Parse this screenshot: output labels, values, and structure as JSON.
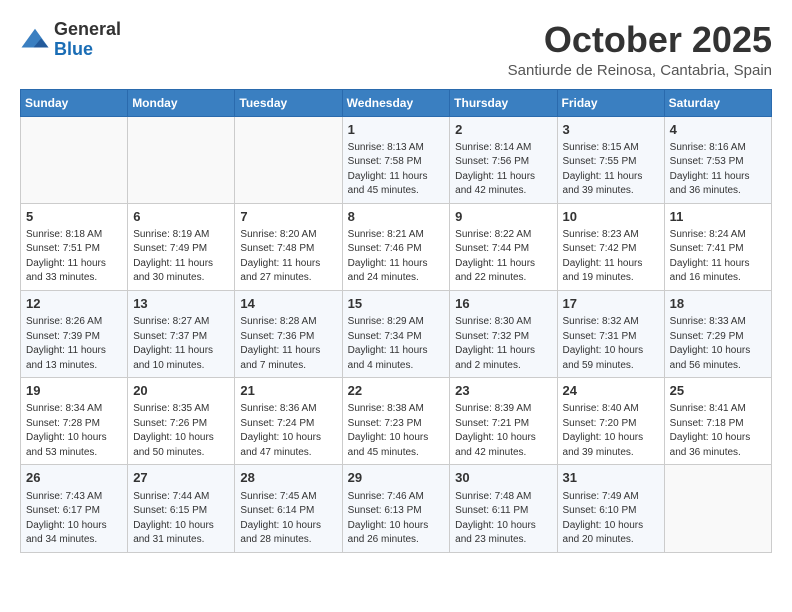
{
  "header": {
    "logo_general": "General",
    "logo_blue": "Blue",
    "month_title": "October 2025",
    "subtitle": "Santiurde de Reinosa, Cantabria, Spain"
  },
  "weekdays": [
    "Sunday",
    "Monday",
    "Tuesday",
    "Wednesday",
    "Thursday",
    "Friday",
    "Saturday"
  ],
  "weeks": [
    [
      {
        "day": "",
        "info": ""
      },
      {
        "day": "",
        "info": ""
      },
      {
        "day": "",
        "info": ""
      },
      {
        "day": "1",
        "info": "Sunrise: 8:13 AM\nSunset: 7:58 PM\nDaylight: 11 hours and 45 minutes."
      },
      {
        "day": "2",
        "info": "Sunrise: 8:14 AM\nSunset: 7:56 PM\nDaylight: 11 hours and 42 minutes."
      },
      {
        "day": "3",
        "info": "Sunrise: 8:15 AM\nSunset: 7:55 PM\nDaylight: 11 hours and 39 minutes."
      },
      {
        "day": "4",
        "info": "Sunrise: 8:16 AM\nSunset: 7:53 PM\nDaylight: 11 hours and 36 minutes."
      }
    ],
    [
      {
        "day": "5",
        "info": "Sunrise: 8:18 AM\nSunset: 7:51 PM\nDaylight: 11 hours and 33 minutes."
      },
      {
        "day": "6",
        "info": "Sunrise: 8:19 AM\nSunset: 7:49 PM\nDaylight: 11 hours and 30 minutes."
      },
      {
        "day": "7",
        "info": "Sunrise: 8:20 AM\nSunset: 7:48 PM\nDaylight: 11 hours and 27 minutes."
      },
      {
        "day": "8",
        "info": "Sunrise: 8:21 AM\nSunset: 7:46 PM\nDaylight: 11 hours and 24 minutes."
      },
      {
        "day": "9",
        "info": "Sunrise: 8:22 AM\nSunset: 7:44 PM\nDaylight: 11 hours and 22 minutes."
      },
      {
        "day": "10",
        "info": "Sunrise: 8:23 AM\nSunset: 7:42 PM\nDaylight: 11 hours and 19 minutes."
      },
      {
        "day": "11",
        "info": "Sunrise: 8:24 AM\nSunset: 7:41 PM\nDaylight: 11 hours and 16 minutes."
      }
    ],
    [
      {
        "day": "12",
        "info": "Sunrise: 8:26 AM\nSunset: 7:39 PM\nDaylight: 11 hours and 13 minutes."
      },
      {
        "day": "13",
        "info": "Sunrise: 8:27 AM\nSunset: 7:37 PM\nDaylight: 11 hours and 10 minutes."
      },
      {
        "day": "14",
        "info": "Sunrise: 8:28 AM\nSunset: 7:36 PM\nDaylight: 11 hours and 7 minutes."
      },
      {
        "day": "15",
        "info": "Sunrise: 8:29 AM\nSunset: 7:34 PM\nDaylight: 11 hours and 4 minutes."
      },
      {
        "day": "16",
        "info": "Sunrise: 8:30 AM\nSunset: 7:32 PM\nDaylight: 11 hours and 2 minutes."
      },
      {
        "day": "17",
        "info": "Sunrise: 8:32 AM\nSunset: 7:31 PM\nDaylight: 10 hours and 59 minutes."
      },
      {
        "day": "18",
        "info": "Sunrise: 8:33 AM\nSunset: 7:29 PM\nDaylight: 10 hours and 56 minutes."
      }
    ],
    [
      {
        "day": "19",
        "info": "Sunrise: 8:34 AM\nSunset: 7:28 PM\nDaylight: 10 hours and 53 minutes."
      },
      {
        "day": "20",
        "info": "Sunrise: 8:35 AM\nSunset: 7:26 PM\nDaylight: 10 hours and 50 minutes."
      },
      {
        "day": "21",
        "info": "Sunrise: 8:36 AM\nSunset: 7:24 PM\nDaylight: 10 hours and 47 minutes."
      },
      {
        "day": "22",
        "info": "Sunrise: 8:38 AM\nSunset: 7:23 PM\nDaylight: 10 hours and 45 minutes."
      },
      {
        "day": "23",
        "info": "Sunrise: 8:39 AM\nSunset: 7:21 PM\nDaylight: 10 hours and 42 minutes."
      },
      {
        "day": "24",
        "info": "Sunrise: 8:40 AM\nSunset: 7:20 PM\nDaylight: 10 hours and 39 minutes."
      },
      {
        "day": "25",
        "info": "Sunrise: 8:41 AM\nSunset: 7:18 PM\nDaylight: 10 hours and 36 minutes."
      }
    ],
    [
      {
        "day": "26",
        "info": "Sunrise: 7:43 AM\nSunset: 6:17 PM\nDaylight: 10 hours and 34 minutes."
      },
      {
        "day": "27",
        "info": "Sunrise: 7:44 AM\nSunset: 6:15 PM\nDaylight: 10 hours and 31 minutes."
      },
      {
        "day": "28",
        "info": "Sunrise: 7:45 AM\nSunset: 6:14 PM\nDaylight: 10 hours and 28 minutes."
      },
      {
        "day": "29",
        "info": "Sunrise: 7:46 AM\nSunset: 6:13 PM\nDaylight: 10 hours and 26 minutes."
      },
      {
        "day": "30",
        "info": "Sunrise: 7:48 AM\nSunset: 6:11 PM\nDaylight: 10 hours and 23 minutes."
      },
      {
        "day": "31",
        "info": "Sunrise: 7:49 AM\nSunset: 6:10 PM\nDaylight: 10 hours and 20 minutes."
      },
      {
        "day": "",
        "info": ""
      }
    ]
  ]
}
